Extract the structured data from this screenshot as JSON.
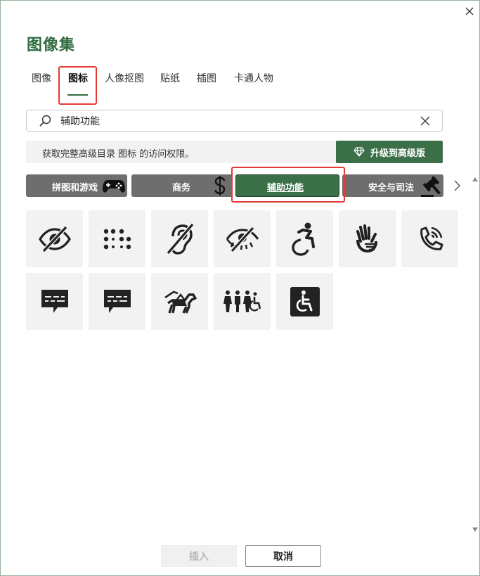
{
  "dialog": {
    "title": "图像集",
    "close_icon": "close-icon"
  },
  "tabs": [
    {
      "label": "图像",
      "active": false
    },
    {
      "label": "图标",
      "active": true
    },
    {
      "label": "人像抠图",
      "active": false
    },
    {
      "label": "贴纸",
      "active": false
    },
    {
      "label": "插图",
      "active": false
    },
    {
      "label": "卡通人物",
      "active": false
    }
  ],
  "search": {
    "value": "辅助功能",
    "placeholder": ""
  },
  "banner": {
    "text": "获取完整高级目录 图标 的访问权限。"
  },
  "upgrade": {
    "label": "升级到高级版",
    "icon": "diamond-icon"
  },
  "categories": [
    {
      "label": "拼图和游戏",
      "icon": "gamepad-icon",
      "active": false
    },
    {
      "label": "商务",
      "icon": "dollar-icon",
      "active": false
    },
    {
      "label": "辅助功能",
      "icon": "",
      "active": true
    },
    {
      "label": "安全与司法",
      "icon": "gavel-icon",
      "active": false
    }
  ],
  "icons": [
    {
      "name": "eye-slash-icon"
    },
    {
      "name": "braille-icon"
    },
    {
      "name": "hearing-impaired-icon"
    },
    {
      "name": "low-vision-icon"
    },
    {
      "name": "active-wheelchair-icon"
    },
    {
      "name": "sign-language-icon"
    },
    {
      "name": "phone-volume-icon"
    },
    {
      "name": "closed-captioning-icon"
    },
    {
      "name": "captions-bubble-icon"
    },
    {
      "name": "guide-dog-icon"
    },
    {
      "name": "accessible-restroom-icon"
    },
    {
      "name": "wheelchair-square-icon"
    }
  ],
  "footer": {
    "insert_label": "插入",
    "cancel_label": "取消"
  },
  "colors": {
    "accent": "#3a6f47",
    "title": "#2f6b3e",
    "highlight": "#e53935",
    "category_bg": "#6e6e6e",
    "tile_bg": "#f2f2f2"
  }
}
